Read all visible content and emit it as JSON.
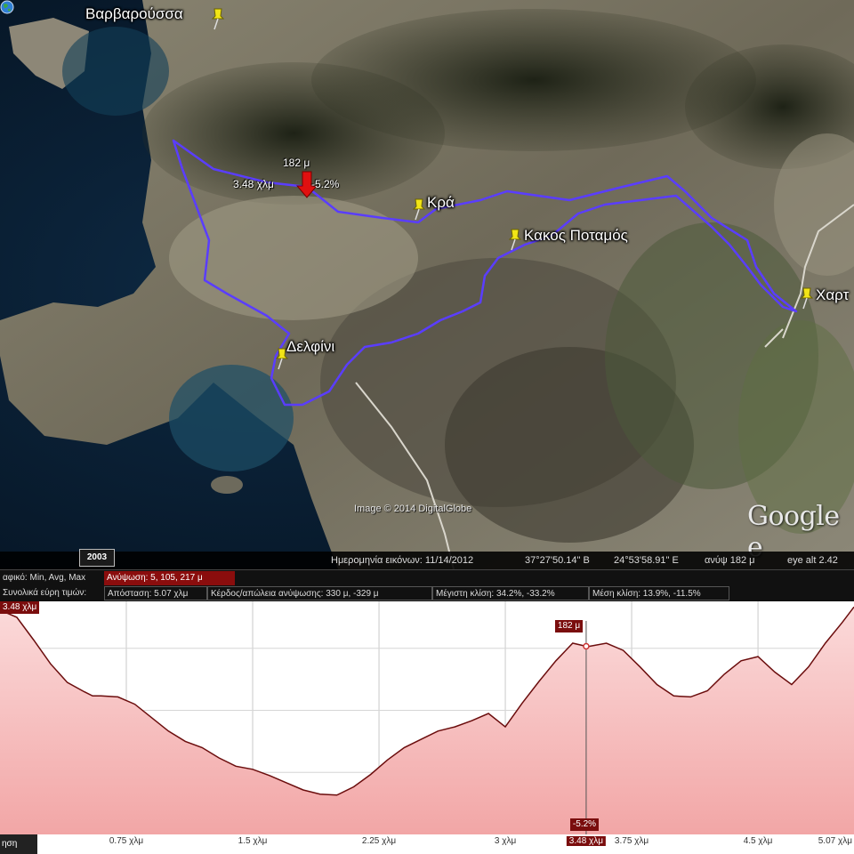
{
  "places": {
    "varvaroussa": "Βαρβαρούσσα",
    "kra": "Κρά",
    "kakos_potamos": "Κακος Ποταμός",
    "chart": "Χαρτ",
    "delfini": "Δελφίνι"
  },
  "tooltip": {
    "elevation": "182 μ",
    "distance": "3.48 χλμ",
    "slope": "-5.2%"
  },
  "map": {
    "imagery_credit": "Image © 2014 DigitalGlobe",
    "logo": "Google e",
    "year_badge": "2003",
    "pin_icon": "yellow-pushpin-icon",
    "route_color": "#5a3dff"
  },
  "status": {
    "date": "Ημερομηνία εικόνων: 11/14/2012",
    "lat": "37°27'50.14\" Β",
    "lon": "24°53'58.91\" Ε",
    "elev": "ανύψ   182 μ",
    "eye": "eye alt  2.42"
  },
  "stats": {
    "graph_label": "αφικό:  Min, Avg, Max",
    "elevation": "Ανύψωση: 5, 105, 217 μ",
    "totals_label": "Συνολικά εύρη τιμών:",
    "distance": "Απόσταση: 5.07 χλμ",
    "gain_loss": "Κέρδος/απώλεια ανύψωσης: 330 μ, -329 μ",
    "max_slope": "Μέγιστη κλίση: 34.2%, -33.2%",
    "avg_slope": "Μέση κλίση: 13.9%, -11.5%"
  },
  "profile": {
    "readout_top": "182 μ",
    "readout_slope": "-5.2%",
    "readout_distance": "3.48 χλμ",
    "tab_label": "ηση",
    "fill_color": "#f4b8b8",
    "line_color": "#6b0d0d"
  },
  "chart_data": {
    "type": "area",
    "x_unit": "χλμ",
    "y_unit": "μ",
    "xlim": [
      0,
      5.07
    ],
    "ylim": [
      0,
      222
    ],
    "x_ticks": [
      "0.75 χλμ",
      "1.5 χλμ",
      "2.25 χλμ",
      "3 χλμ",
      "3.48 χλμ",
      "3.75 χλμ",
      "4.5 χλμ",
      "5.07 χλμ"
    ],
    "series": [
      {
        "x": [
          0,
          0.1,
          0.2,
          0.3,
          0.4,
          0.5,
          0.55,
          0.6,
          0.7,
          0.8,
          0.9,
          1.0,
          1.1,
          1.2,
          1.3,
          1.4,
          1.5,
          1.6,
          1.7,
          1.8,
          1.9,
          2.0,
          2.1,
          2.2,
          2.3,
          2.4,
          2.5,
          2.6,
          2.7,
          2.8,
          2.9,
          3.0,
          3.1,
          3.2,
          3.3,
          3.4,
          3.48,
          3.5,
          3.6,
          3.7,
          3.8,
          3.9,
          4.0,
          4.1,
          4.2,
          4.3,
          4.4,
          4.5,
          4.6,
          4.7,
          4.8,
          4.9,
          5.0,
          5.07
        ],
        "y": [
          217,
          210,
          188,
          165,
          147,
          138,
          134,
          134,
          133,
          126,
          113,
          100,
          90,
          84,
          74,
          66,
          63,
          57,
          50,
          43,
          39,
          38,
          46,
          58,
          72,
          84,
          92,
          100,
          104,
          110,
          117,
          104,
          127,
          148,
          168,
          185,
          182,
          182,
          185,
          178,
          162,
          145,
          134,
          133,
          139,
          155,
          168,
          172,
          157,
          145,
          162,
          185,
          205,
          220
        ]
      }
    ]
  }
}
